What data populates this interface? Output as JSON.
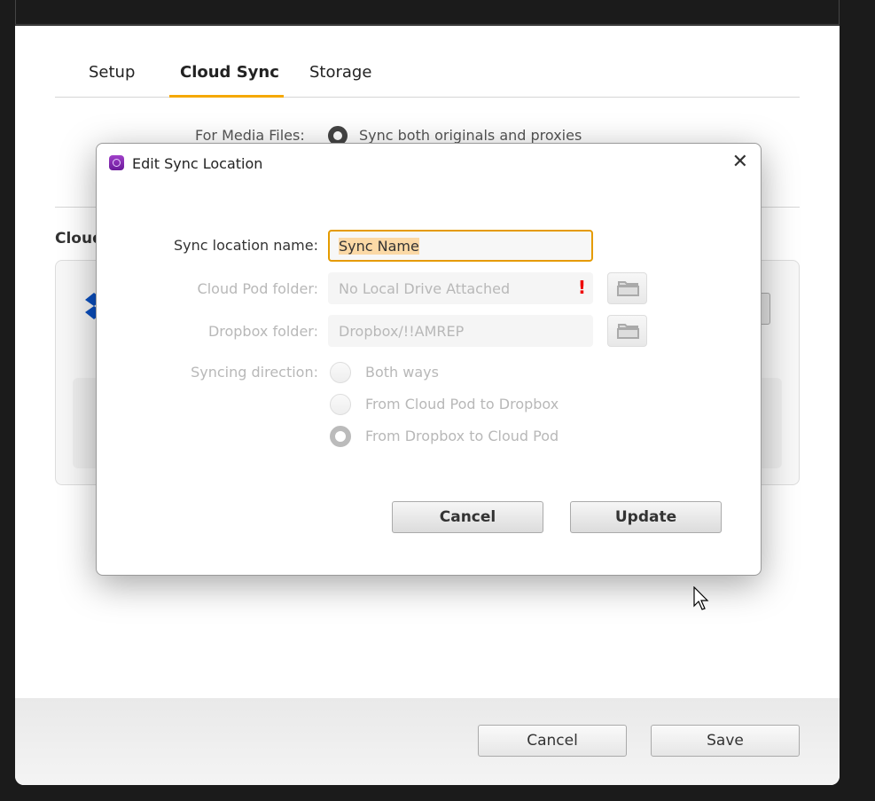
{
  "tabs": [
    {
      "label": "Setup"
    },
    {
      "label": "Cloud Sync"
    },
    {
      "label": "Storage"
    }
  ],
  "media": {
    "label": "For Media Files:",
    "option": "Sync both originals and proxies"
  },
  "section_heading": "Cloud",
  "footer": {
    "cancel": "Cancel",
    "save": "Save"
  },
  "dialog": {
    "title": "Edit Sync Location",
    "name_label": "Sync location name:",
    "name_value": "Sync Name",
    "pod_label": "Cloud Pod folder:",
    "pod_value": "No Local Drive Attached",
    "pod_warning": "!",
    "dropbox_label": "Dropbox folder:",
    "dropbox_value": "Dropbox/!!AMREP",
    "direction_label": "Syncing direction:",
    "directions": [
      {
        "label": "Both ways",
        "checked": false
      },
      {
        "label": "From Cloud Pod to Dropbox",
        "checked": false
      },
      {
        "label": "From Dropbox to Cloud Pod",
        "checked": true
      }
    ],
    "cancel": "Cancel",
    "update": "Update"
  },
  "colors": {
    "accent": "#f5a800",
    "warning": "#e00000"
  }
}
